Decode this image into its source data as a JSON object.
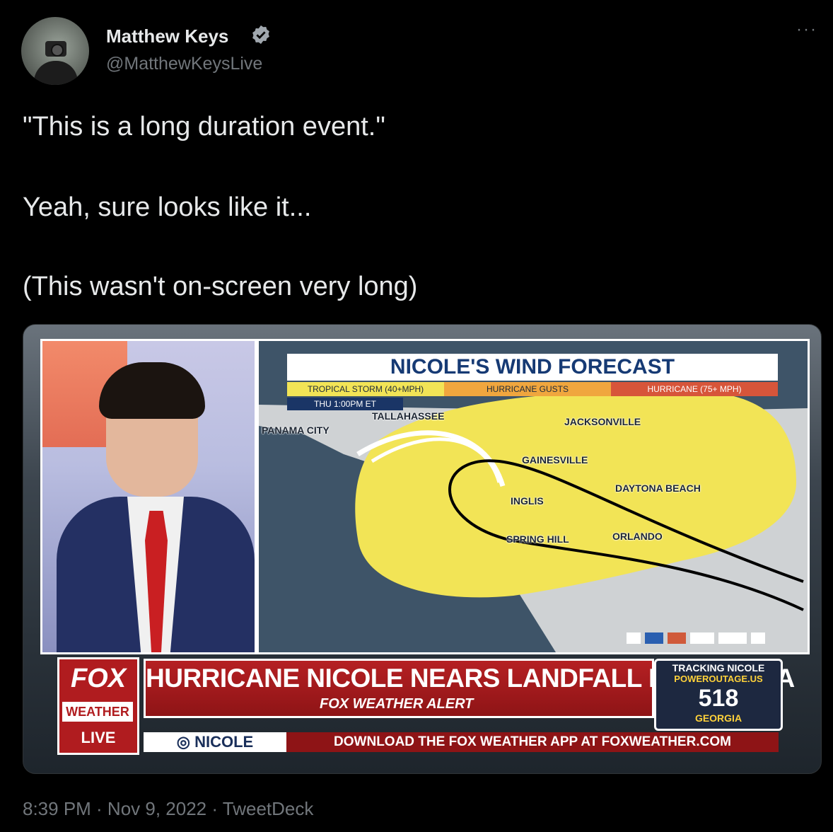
{
  "author": {
    "name": "Matthew Keys",
    "handle": "@MatthewKeysLive"
  },
  "menu": {
    "more_label": "···"
  },
  "tweet": {
    "line1": "\"This is a long duration event.\"",
    "line2": "Yeah, sure looks like it...",
    "line3": "(This wasn't on-screen very long)"
  },
  "media": {
    "map": {
      "title": "NICOLE'S WIND FORECAST",
      "legend": [
        "TROPICAL STORM (40+MPH)",
        "HURRICANE GUSTS",
        "HURRICANE (75+ MPH)"
      ],
      "time": "THU   1:00PM ET",
      "cities": [
        "TALLAHASSEE",
        "PANAMA CITY",
        "JACKSONVILLE",
        "GAINESVILLE",
        "DAYTONA BEACH",
        "INGLIS",
        "SPRING HILL",
        "ORLANDO"
      ]
    },
    "lower_third": {
      "logo_fox": "FOX",
      "logo_weather": "WEATHER",
      "logo_live": "LIVE",
      "headline": "HURRICANE NICOLE NEARS LANDFALL IN FLORIDA",
      "alert": "FOX WEATHER ALERT",
      "tracker_title": "TRACKING NICOLE",
      "tracker_source": "POWEROUTAGE.US",
      "tracker_value": "518",
      "tracker_state": "GEORGIA",
      "ticker_tag": "◎ NICOLE",
      "ticker_text": "DOWNLOAD THE FOX WEATHER APP AT FOXWEATHER.COM"
    }
  },
  "footer": "8:39 PM · Nov 9, 2022 · TweetDeck",
  "colors": {
    "background": "#000000",
    "text": "#e7e9ea",
    "secondary": "#71767b",
    "verified": "#a0a7ae",
    "storm_yellow": "#f2e456",
    "fox_red": "#b01c1f"
  }
}
